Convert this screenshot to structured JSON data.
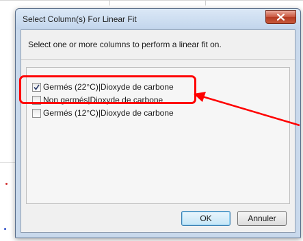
{
  "dialog": {
    "title": "Select Column(s) For Linear Fit",
    "prompt": "Select one or more columns to perform a linear fit on.",
    "columns": [
      {
        "label": "Germés (22°C)|Dioxyde de carbone",
        "checked": true
      },
      {
        "label": "Non germés|Dioxyde de carbone",
        "checked": false
      },
      {
        "label": "Germés (12°C)|Dioxyde de carbone",
        "checked": false
      }
    ],
    "ok_label": "OK",
    "cancel_label": "Annuler",
    "close_icon": "close-icon"
  },
  "annotation": {
    "color": "#ff0000"
  }
}
